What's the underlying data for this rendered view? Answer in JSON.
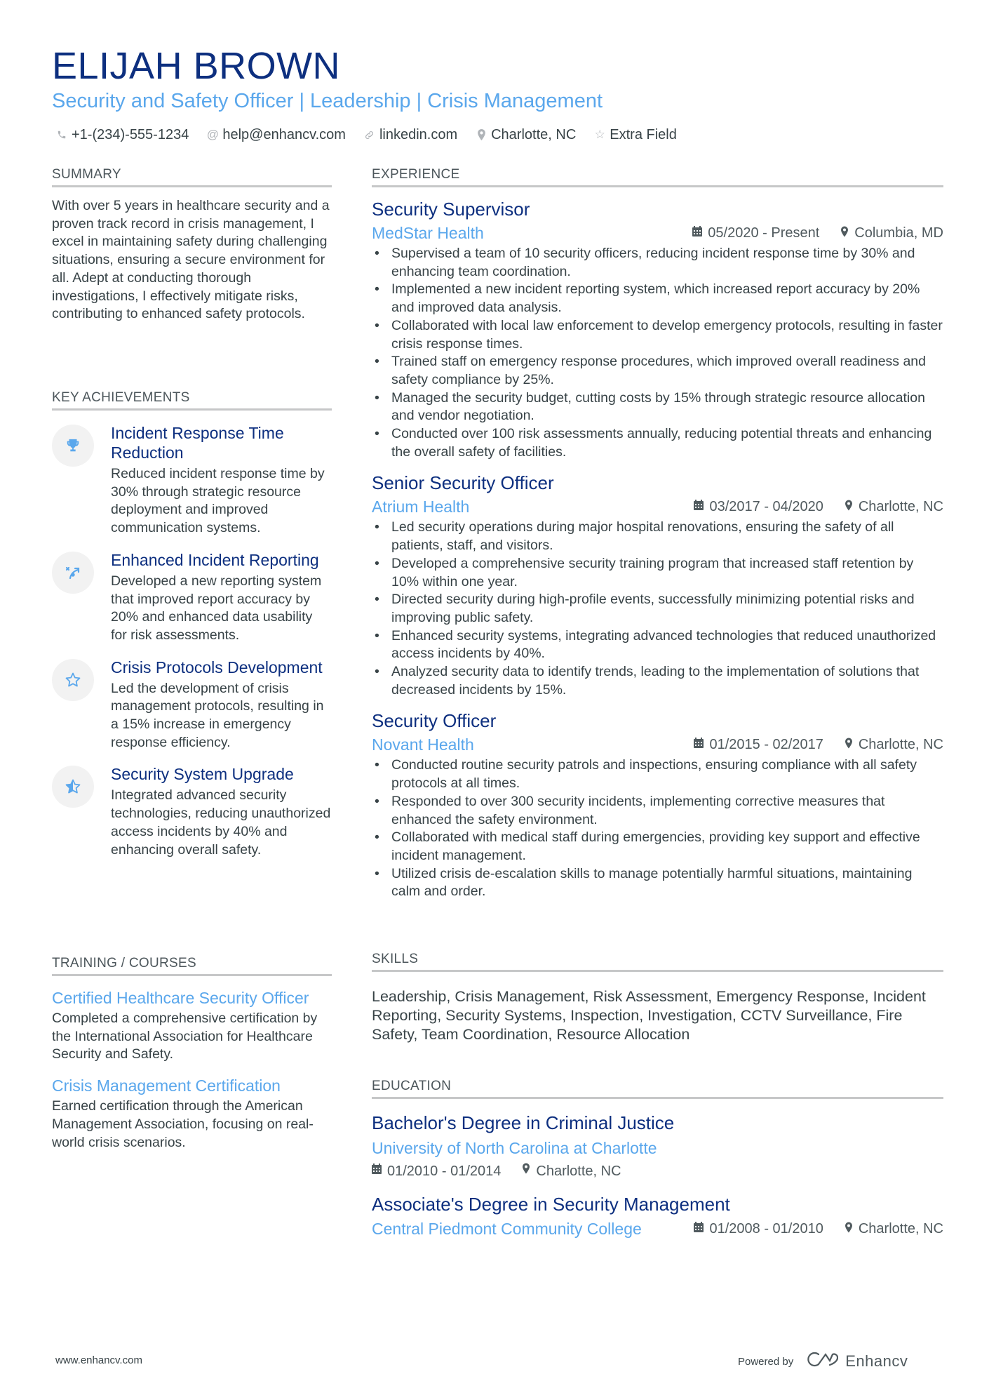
{
  "header": {
    "name": "ELIJAH BROWN",
    "headline": "Security and Safety Officer | Leadership | Crisis Management",
    "contacts": [
      {
        "icon": "phone-icon",
        "glyph": "✆",
        "text": "+1-(234)-555-1234"
      },
      {
        "icon": "at-icon",
        "glyph": "@",
        "text": "help@enhancv.com"
      },
      {
        "icon": "link-icon",
        "glyph": "🔗",
        "text": "linkedin.com"
      },
      {
        "icon": "location-icon",
        "glyph": "⚲",
        "text": "Charlotte, NC"
      },
      {
        "icon": "star-icon",
        "glyph": "☆",
        "text": "Extra Field"
      }
    ]
  },
  "summary": {
    "title": "SUMMARY",
    "text": "With over 5 years in healthcare security and a proven track record in crisis management, I excel in maintaining safety during challenging situations, ensuring a secure environment for all. Adept at conducting thorough investigations, I effectively mitigate risks, contributing to enhanced safety protocols."
  },
  "achievements": {
    "title": "KEY ACHIEVEMENTS",
    "items": [
      {
        "icon": "trophy-icon",
        "glyph": "🏆",
        "title": "Incident Response Time Reduction",
        "text": "Reduced incident response time by 30% through strategic resource deployment and improved communication systems."
      },
      {
        "icon": "strategy-icon",
        "glyph": "⤴",
        "title": "Enhanced Incident Reporting",
        "text": "Developed a new reporting system that improved report accuracy by 20% and enhanced data usability for risk assessments."
      },
      {
        "icon": "star-icon",
        "glyph": "☆",
        "title": "Crisis Protocols Development",
        "text": "Led the development of crisis management protocols, resulting in a 15% increase in emergency response efficiency."
      },
      {
        "icon": "star-half-icon",
        "glyph": "★",
        "title": "Security System Upgrade",
        "text": "Integrated advanced security technologies, reducing unauthorized access incidents by 40% and enhancing overall safety."
      }
    ]
  },
  "training": {
    "title": "TRAINING / COURSES",
    "items": [
      {
        "title": "Certified Healthcare Security Officer",
        "text": "Completed a comprehensive certification by the International Association for Healthcare Security and Safety."
      },
      {
        "title": "Crisis Management Certification",
        "text": "Earned certification through the American Management Association, focusing on real-world crisis scenarios."
      }
    ]
  },
  "experience": {
    "title": "EXPERIENCE",
    "jobs": [
      {
        "title": "Security Supervisor",
        "company": "MedStar Health",
        "dates": "05/2020 - Present",
        "location": "Columbia, MD",
        "bullets": [
          "Supervised a team of 10 security officers, reducing incident response time by 30% and enhancing team coordination.",
          "Implemented a new incident reporting system, which increased report accuracy by 20% and improved data analysis.",
          "Collaborated with local law enforcement to develop emergency protocols, resulting in faster crisis response times.",
          "Trained staff on emergency response procedures, which improved overall readiness and safety compliance by 25%.",
          "Managed the security budget, cutting costs by 15% through strategic resource allocation and vendor negotiation.",
          "Conducted over 100 risk assessments annually, reducing potential threats and enhancing the overall safety of facilities."
        ]
      },
      {
        "title": "Senior Security Officer",
        "company": "Atrium Health",
        "dates": "03/2017 - 04/2020",
        "location": "Charlotte, NC",
        "bullets": [
          "Led security operations during major hospital renovations, ensuring the safety of all patients, staff, and visitors.",
          "Developed a comprehensive security training program that increased staff retention by 10% within one year.",
          "Directed security during high-profile events, successfully minimizing potential risks and improving public safety.",
          "Enhanced security systems, integrating advanced technologies that reduced unauthorized access incidents by 40%.",
          "Analyzed security data to identify trends, leading to the implementation of solutions that decreased incidents by 15%."
        ]
      },
      {
        "title": "Security Officer",
        "company": "Novant Health",
        "dates": "01/2015 - 02/2017",
        "location": "Charlotte, NC",
        "bullets": [
          "Conducted routine security patrols and inspections, ensuring compliance with all safety protocols at all times.",
          "Responded to over 300 security incidents, implementing corrective measures that enhanced the safety environment.",
          "Collaborated with medical staff during emergencies, providing key support and effective incident management.",
          "Utilized crisis de-escalation skills to manage potentially harmful situations, maintaining calm and order."
        ]
      }
    ]
  },
  "skills": {
    "title": "SKILLS",
    "text": "Leadership, Crisis Management, Risk Assessment, Emergency Response, Incident Reporting, Security Systems, Inspection, Investigation, CCTV Surveillance, Fire Safety, Team Coordination, Resource Allocation"
  },
  "education": {
    "title": "EDUCATION",
    "items": [
      {
        "degree": "Bachelor's Degree in Criminal Justice",
        "school": "University of North Carolina at Charlotte",
        "dates": "01/2010 - 01/2014",
        "location": "Charlotte, NC"
      },
      {
        "degree": "Associate's Degree in Security Management",
        "school": "Central Piedmont Community College",
        "dates": "01/2008 - 01/2010",
        "location": "Charlotte, NC"
      }
    ]
  },
  "footer": {
    "website": "www.enhancv.com",
    "powered_by": "Powered by",
    "brand": "Enhancv"
  },
  "colors": {
    "name": "#0d2f7f",
    "accent": "#5aa7ec",
    "text": "#384347",
    "rule": "#c6c7c8"
  }
}
